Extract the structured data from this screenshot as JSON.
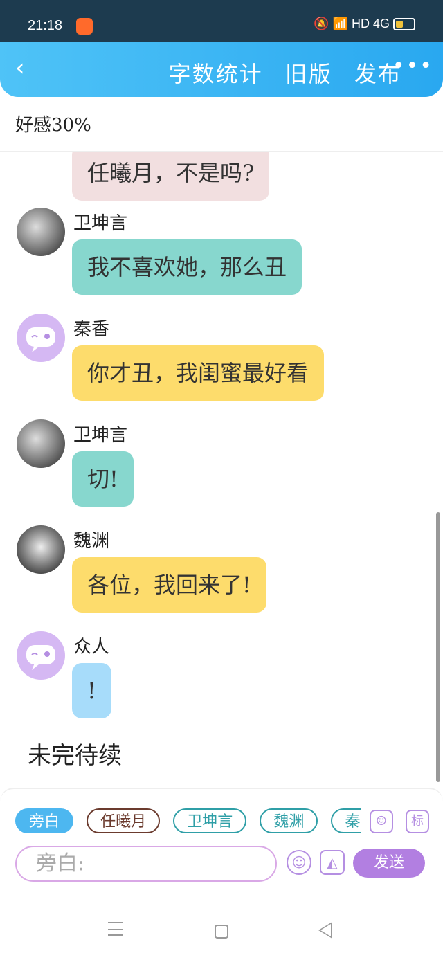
{
  "status_bar": {
    "time": "21:18",
    "network_label": "HD",
    "signal_label": "4G"
  },
  "header": {
    "word_count": "字数统计",
    "old_version": "旧版",
    "publish": "发布",
    "more": "•••"
  },
  "favor": "好感30%",
  "messages": [
    {
      "speaker": "",
      "text": "任曦月，不是吗?",
      "color": "pink"
    },
    {
      "speaker": "卫坤言",
      "text": "我不喜欢她，那么丑",
      "color": "teal"
    },
    {
      "speaker": "秦香",
      "text": "你才丑，我闺蜜最好看",
      "color": "yellow"
    },
    {
      "speaker": "卫坤言",
      "text": "切!",
      "color": "teal"
    },
    {
      "speaker": "魏渊",
      "text": "各位，我回来了!",
      "color": "yellow"
    },
    {
      "speaker": "众人",
      "text": "!",
      "color": "blue"
    }
  ],
  "unfinished": "未完待续",
  "composer": {
    "roles": [
      "旁白",
      "任曦月",
      "卫坤言",
      "魏渊",
      "秦"
    ],
    "role_button": "",
    "tag_button": "标",
    "input_placeholder": "旁白:",
    "send": "发送"
  },
  "colors": {
    "teal": "#87d7ce",
    "yellow": "#fddc6c",
    "blue": "#a7dcfa",
    "pink": "#f2dfe0",
    "accent": "#b27fe1",
    "header": "#29a8f0"
  }
}
